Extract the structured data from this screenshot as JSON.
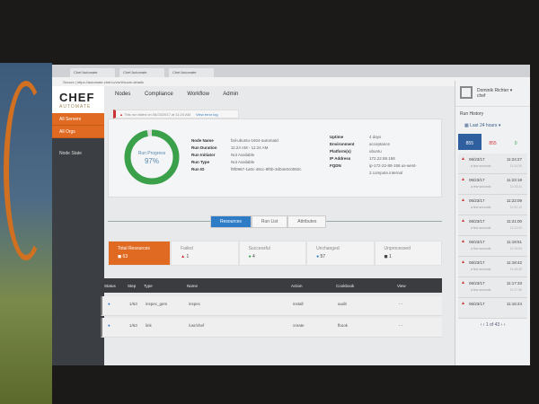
{
  "browser": {
    "tabs": [
      "Chef Automate",
      "Chef Automate",
      "Chef Automate"
    ],
    "address": "Secure | https://automate.chef.io/viz/#/node-details"
  },
  "logo": {
    "title": "CHEF",
    "subtitle": "AUTOMATE"
  },
  "sidebar": {
    "items": [
      {
        "label": "All Servers"
      },
      {
        "label": "All Orgs"
      }
    ],
    "section": "Node State"
  },
  "nav": [
    "Nodes",
    "Compliance",
    "Workflow",
    "Admin"
  ],
  "alert": {
    "text": "This run failed on 06/23/2017 at 11:24 AM",
    "link": "View error log"
  },
  "run": {
    "progress_label": "Run Progress",
    "progress": "97%",
    "progress_value": 97,
    "fields": [
      {
        "k": "Node Name",
        "v": "fail-ubuntu-1604-automatd"
      },
      {
        "k": "Run Duration",
        "v": "11:24 AM - 11:24 AM"
      },
      {
        "k": "Run Initiator",
        "v": "Not Available"
      },
      {
        "k": "Run Type",
        "v": "Not Available"
      },
      {
        "k": "Run ID",
        "v": "f9f0967-1a0c-48cc-9f0b-3d04e0c0082c"
      }
    ],
    "fields2": [
      {
        "k": "Uptime",
        "v": "4 days"
      },
      {
        "k": "Environment",
        "v": "acceptance"
      },
      {
        "k": "Platform(s)",
        "v": "ubuntu"
      },
      {
        "k": "IP Address",
        "v": "172.22.88.158"
      },
      {
        "k": "FQDN",
        "v": "ip-172-22-88-158.us-west-2.compute.internal"
      }
    ]
  },
  "tabs": [
    "Resources",
    "Run List",
    "Attributes"
  ],
  "stats": [
    {
      "label": "Total Resources",
      "value": "63"
    },
    {
      "label": "Failed",
      "value": "1"
    },
    {
      "label": "Successful",
      "value": "4"
    },
    {
      "label": "Unchanged",
      "value": "57"
    },
    {
      "label": "Unprocessed",
      "value": "1"
    }
  ],
  "table": {
    "headers": [
      "Status",
      "Step",
      "Type",
      "Name",
      "Action",
      "Cookbook",
      "View"
    ],
    "rows": [
      [
        "",
        "1/63",
        "inspec_gem",
        "inspec",
        "install",
        "audit",
        "- -"
      ],
      [
        "",
        "1/63",
        "link",
        "/usr/chef",
        "create",
        "fbook",
        "- -"
      ]
    ]
  },
  "colors": {
    "accent": "#e06a22",
    "primary": "#2f7cc6",
    "failed": "#cc3333",
    "success": "#3aa14a"
  },
  "right": {
    "user": "Dominik Richter",
    "org": "chef",
    "title": "Run History",
    "range": "Last 24 hours",
    "counts": [
      "855",
      "855",
      "0"
    ],
    "history": [
      {
        "d": "06/23/17",
        "t": "11:24:27",
        "s": "a few seconds",
        "t2": "11:24:30"
      },
      {
        "d": "06/23/17",
        "t": "11:23:18",
        "s": "a few seconds",
        "t2": "11:23:21"
      },
      {
        "d": "06/23/17",
        "t": "11:22:09",
        "s": "a few seconds",
        "t2": "11:22:12"
      },
      {
        "d": "06/23/17",
        "t": "11:21:00",
        "s": "a few seconds",
        "t2": "11:21:03"
      },
      {
        "d": "06/23/17",
        "t": "11:19:51",
        "s": "a few seconds",
        "t2": "11:19:54"
      },
      {
        "d": "06/23/17",
        "t": "11:18:42",
        "s": "a few seconds",
        "t2": "11:18:45"
      },
      {
        "d": "06/23/17",
        "t": "11:17:33",
        "s": "a few seconds",
        "t2": "11:17:36"
      },
      {
        "d": "06/23/17",
        "t": "11:16:24",
        "s": "",
        "t2": ""
      }
    ],
    "pager": "1 of 43"
  }
}
